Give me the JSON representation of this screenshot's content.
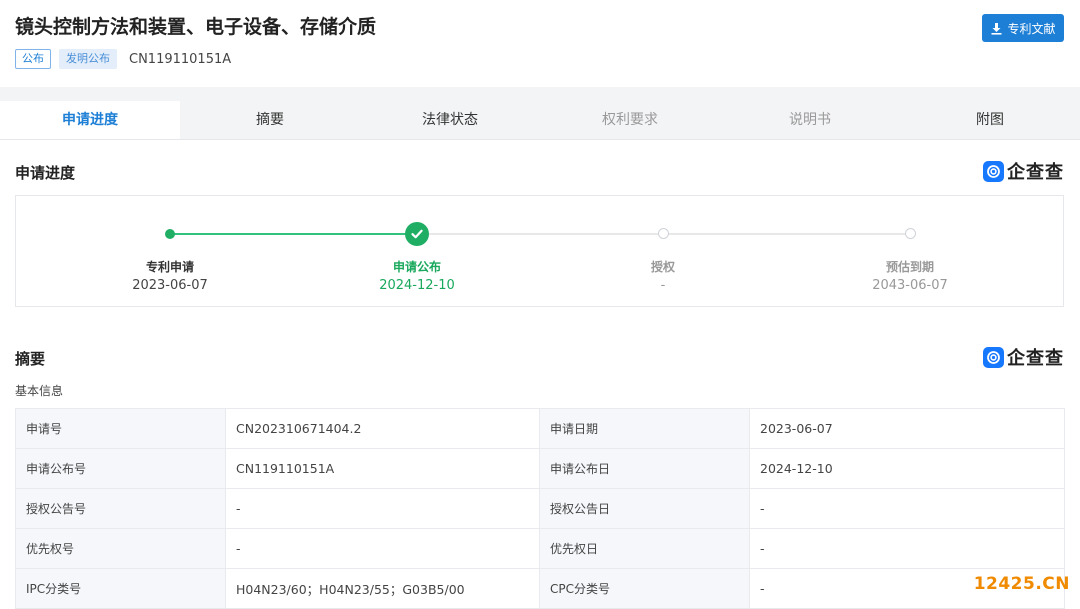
{
  "header": {
    "title": "镜头控制方法和装置、电子设备、存储介质",
    "tags": [
      "公布",
      "发明公布"
    ],
    "publication_number": "CN119110151A",
    "doc_button_label": "专利文献"
  },
  "tabs": [
    {
      "label": "申请进度",
      "state": "active"
    },
    {
      "label": "摘要",
      "state": "normal"
    },
    {
      "label": "法律状态",
      "state": "normal"
    },
    {
      "label": "权利要求",
      "state": "disabled"
    },
    {
      "label": "说明书",
      "state": "disabled"
    },
    {
      "label": "附图",
      "state": "normal"
    }
  ],
  "brand": {
    "text": "企查查",
    "color": "#1677ff"
  },
  "progress": {
    "title": "申请进度",
    "steps": [
      {
        "label": "专利申请",
        "date": "2023-06-07",
        "status": "done"
      },
      {
        "label": "申请公布",
        "date": "2024-12-10",
        "status": "current"
      },
      {
        "label": "授权",
        "date": "-",
        "status": "pending"
      },
      {
        "label": "预估到期",
        "date": "2043-06-07",
        "status": "pending"
      }
    ]
  },
  "abstract": {
    "title": "摘要",
    "subtitle": "基本信息",
    "rows": [
      [
        {
          "k": "申请号",
          "v": "CN202310671404.2"
        },
        {
          "k": "申请日期",
          "v": "2023-06-07"
        }
      ],
      [
        {
          "k": "申请公布号",
          "v": "CN119110151A"
        },
        {
          "k": "申请公布日",
          "v": "2024-12-10"
        }
      ],
      [
        {
          "k": "授权公告号",
          "v": "-"
        },
        {
          "k": "授权公告日",
          "v": "-"
        }
      ],
      [
        {
          "k": "优先权号",
          "v": "-"
        },
        {
          "k": "优先权日",
          "v": "-"
        }
      ],
      [
        {
          "k": "IPC分类号",
          "v": "H04N23/60；H04N23/55；G03B5/00"
        },
        {
          "k": "CPC分类号",
          "v": "-"
        }
      ]
    ]
  },
  "watermark": "12425.CN",
  "colors": {
    "accent": "#1e7fd6",
    "success": "#1fae64",
    "watermark": "#f08a00"
  }
}
